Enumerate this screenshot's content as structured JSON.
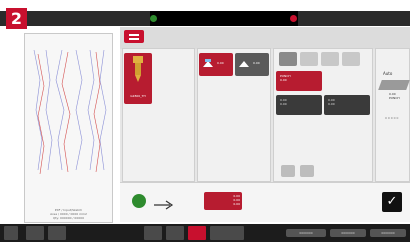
{
  "step_number": "2",
  "preview": {
    "caption_lines": [
      "PXF / Input/Sketch",
      "Area / 0000 / 0000 mm2",
      "Qty: 000000 / 00000"
    ]
  },
  "main": {
    "tool_card": {
      "label": "G2800_TH"
    },
    "source_cards": [
      {
        "label": "0.00"
      },
      {
        "label": "0.00"
      }
    ],
    "param_cards": [
      {
        "label": "PUNCH\n0.00"
      },
      {
        "label": "0.00\n0.00"
      },
      {
        "label": "0.00\n0.00"
      }
    ],
    "right_panel": {
      "title": "Auto",
      "sub": "0.00\nPUNCH",
      "note": "0 0 0 0 0"
    },
    "action_value_card": {
      "label": "0.00\n0.00\n0.00"
    }
  },
  "bottom": {
    "pills": [
      "0000000",
      "0000000",
      "0000000"
    ]
  },
  "icons": [
    "menu-icon",
    "tool-icon",
    "preview-icon",
    "power-icon",
    "arrow-right-icon",
    "confirm-check-icon",
    "hamburger-icon",
    "wrench-icon",
    "person-icon",
    "hand-icon",
    "cursor-icon"
  ],
  "colors": {
    "accent_red": "#c8102e",
    "status_green": "#2e8b2e",
    "status_red": "#c8102e"
  }
}
